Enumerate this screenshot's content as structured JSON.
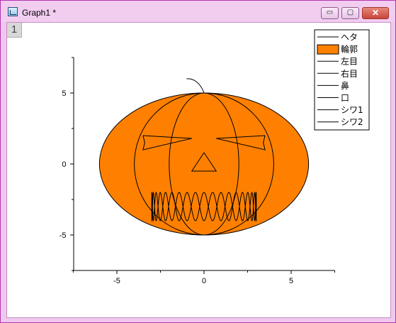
{
  "window": {
    "title": "Graph1 *",
    "min_icon": "minimize-icon",
    "max_icon": "maximize-icon",
    "close_icon": "close-icon",
    "min_glyph": "▭",
    "max_glyph": "▢",
    "close_glyph": "✕"
  },
  "graph": {
    "layer_label": "1"
  },
  "chart_data": {
    "type": "line",
    "title": "",
    "xlabel": "",
    "ylabel": "",
    "xlim": [
      -7.5,
      7.5
    ],
    "ylim": [
      -7.5,
      7.5
    ],
    "x_ticks": [
      "-5",
      "0",
      "5"
    ],
    "y_ticks": [
      "-5",
      "0",
      "5"
    ],
    "grid": false,
    "legend_position": "top-right",
    "legend": [
      "ヘタ",
      "輪郭",
      "左目",
      "右目",
      "鼻",
      "口",
      "シワ1",
      "シワ2"
    ],
    "colors": {
      "fill": "#ff8000",
      "line": "#000000"
    },
    "series": [
      {
        "name": "ヘタ",
        "x": [
          -1.0,
          -0.6,
          -0.2,
          0.0
        ],
        "y": [
          6.0,
          6.05,
          5.7,
          5.0
        ]
      },
      {
        "name": "輪郭",
        "shape": "ellipse",
        "center": [
          0,
          0
        ],
        "rx": 6,
        "ry": 5,
        "fill": "#ff8000"
      },
      {
        "name": "左目",
        "x": [
          -3.5,
          -0.7,
          -3.5,
          -3.4,
          -3.5
        ],
        "y": [
          2.0,
          1.8,
          1.0,
          1.5,
          2.0
        ]
      },
      {
        "name": "右目",
        "x": [
          3.5,
          0.7,
          3.5,
          3.4,
          3.5
        ],
        "y": [
          2.0,
          1.8,
          1.0,
          1.5,
          2.0
        ]
      },
      {
        "name": "鼻",
        "x": [
          0.0,
          -0.7,
          0.7,
          0.0
        ],
        "y": [
          0.8,
          -0.5,
          -0.5,
          0.8
        ]
      },
      {
        "name": "口",
        "shape": "zigzag-loop",
        "xrange": [
          -3,
          3
        ],
        "yrange": [
          -4,
          -2
        ]
      },
      {
        "name": "シワ1",
        "shape": "ellipse",
        "center": [
          0,
          0
        ],
        "rx": 4,
        "ry": 5
      },
      {
        "name": "シワ2",
        "shape": "ellipse",
        "center": [
          0,
          0
        ],
        "rx": 2,
        "ry": 5
      }
    ]
  }
}
